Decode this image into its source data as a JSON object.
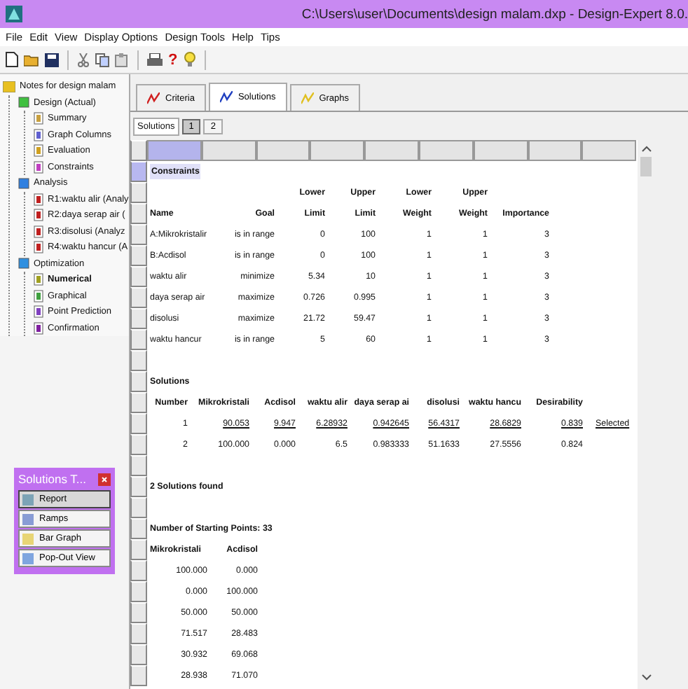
{
  "window": {
    "title": "C:\\Users\\user\\Documents\\design malam.dxp - Design-Expert 8.0."
  },
  "menu": [
    "File",
    "Edit",
    "View",
    "Display Options",
    "Design Tools",
    "Help",
    "Tips"
  ],
  "toolbar": {
    "help_glyph": "?"
  },
  "tree": [
    {
      "label": "Notes for design malam",
      "kind": "folder",
      "selected": false,
      "children": [
        {
          "label": "Design (Actual)",
          "kind": "design",
          "selected": false,
          "children": [
            {
              "label": "Summary",
              "kind": "summary",
              "selected": false
            },
            {
              "label": "Graph Columns",
              "kind": "graph",
              "selected": false
            },
            {
              "label": "Evaluation",
              "kind": "evaluation",
              "selected": false
            },
            {
              "label": "Constraints",
              "kind": "constraints",
              "selected": false
            }
          ]
        },
        {
          "label": "Analysis",
          "kind": "analysis",
          "selected": false,
          "children": [
            {
              "label": "R1:waktu alir (Analy",
              "kind": "response",
              "selected": false
            },
            {
              "label": "R2:daya serap air (",
              "kind": "response",
              "selected": false
            },
            {
              "label": "R3:disolusi (Analyz",
              "kind": "response",
              "selected": false
            },
            {
              "label": "R4:waktu hancur (A",
              "kind": "response",
              "selected": false
            }
          ]
        },
        {
          "label": "Optimization",
          "kind": "optimization",
          "selected": false,
          "children": [
            {
              "label": "Numerical",
              "kind": "numerical",
              "selected": true
            },
            {
              "label": "Graphical",
              "kind": "graphical",
              "selected": false
            },
            {
              "label": "Point Prediction",
              "kind": "prediction",
              "selected": false
            },
            {
              "label": "Confirmation",
              "kind": "confirmation",
              "selected": false
            }
          ]
        }
      ]
    }
  ],
  "tool_window": {
    "title": "Solutions T...",
    "buttons": [
      {
        "label": "Report",
        "kind": "report",
        "selected": true
      },
      {
        "label": "Ramps",
        "kind": "ramps",
        "selected": false
      },
      {
        "label": "Bar Graph",
        "kind": "bar",
        "selected": false
      },
      {
        "label": "Pop-Out View",
        "kind": "popout",
        "selected": false
      }
    ]
  },
  "tabs": [
    {
      "label": "Criteria",
      "kind": "criteria",
      "selected": false
    },
    {
      "label": "Solutions",
      "kind": "solutions",
      "selected": true
    },
    {
      "label": "Graphs",
      "kind": "graphs",
      "selected": false
    }
  ],
  "subtabs": {
    "label": "Solutions",
    "items": [
      {
        "label": "1",
        "selected": true
      },
      {
        "label": "2",
        "selected": false
      }
    ]
  },
  "report": {
    "constraints": {
      "title": "Constraints",
      "columns": [
        {
          "label": "Name"
        },
        {
          "label": "Goal"
        },
        {
          "top": "Lower",
          "label": "Limit"
        },
        {
          "top": "Upper",
          "label": "Limit"
        },
        {
          "top": "Lower",
          "label": "Weight"
        },
        {
          "top": "Upper",
          "label": "Weight"
        },
        {
          "label": "Importance"
        }
      ],
      "rows": [
        [
          "A:Mikrokristalir",
          "is in range",
          "0",
          "100",
          "1",
          "1",
          "3"
        ],
        [
          "B:Acdisol",
          "is in range",
          "0",
          "100",
          "1",
          "1",
          "3"
        ],
        [
          "waktu alir",
          "minimize",
          "5.34",
          "10",
          "1",
          "1",
          "3"
        ],
        [
          "daya serap air",
          "maximize",
          "0.726",
          "0.995",
          "1",
          "1",
          "3"
        ],
        [
          "disolusi",
          "maximize",
          "21.72",
          "59.47",
          "1",
          "1",
          "3"
        ],
        [
          "waktu hancur",
          "is in range",
          "5",
          "60",
          "1",
          "1",
          "3"
        ]
      ]
    },
    "solutions": {
      "title": "Solutions",
      "columns": [
        "Number",
        "Mikrokristali",
        "Acdisol",
        "waktu alir",
        "daya serap ai",
        "disolusi",
        "waktu hancu",
        "Desirability"
      ],
      "rows": [
        {
          "cells": [
            "1",
            "90.053",
            "9.947",
            "6.28932",
            "0.942645",
            "56.4317",
            "28.6829",
            "0.839"
          ],
          "selected": true,
          "note": "Selected"
        },
        {
          "cells": [
            "2",
            "100.000",
            "0.000",
            "6.5",
            "0.983333",
            "51.1633",
            "27.5556",
            "0.824"
          ],
          "selected": false
        }
      ]
    },
    "found": "2 Solutions found",
    "starting": {
      "title": "Number of Starting Points: 33",
      "columns": [
        "Mikrokristali",
        "Acdisol"
      ],
      "rows": [
        [
          "100.000",
          "0.000"
        ],
        [
          "0.000",
          "100.000"
        ],
        [
          "50.000",
          "50.000"
        ],
        [
          "71.517",
          "28.483"
        ],
        [
          "30.932",
          "69.068"
        ],
        [
          "28.938",
          "71.070"
        ]
      ]
    }
  }
}
